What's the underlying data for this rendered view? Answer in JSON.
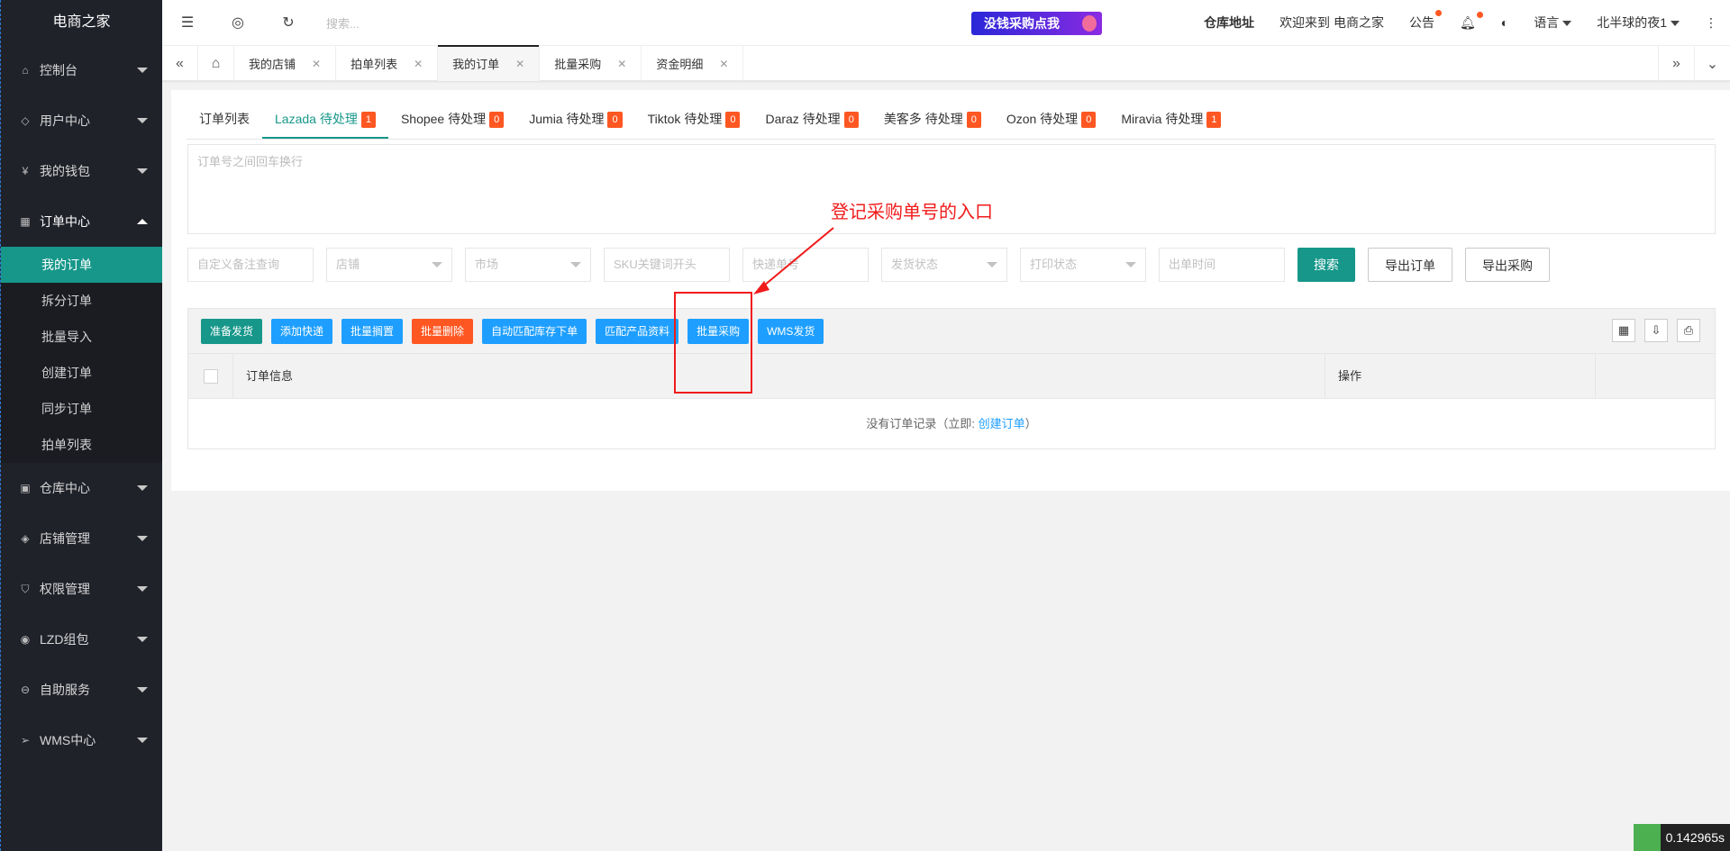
{
  "app": {
    "title": "电商之家"
  },
  "sidebar": {
    "groups": [
      {
        "label": "控制台",
        "icon": "home-icon"
      },
      {
        "label": "用户中心",
        "icon": "diamond-icon"
      },
      {
        "label": "我的钱包",
        "icon": "wallet-icon"
      },
      {
        "label": "订单中心",
        "icon": "apps-icon",
        "open": true,
        "items": [
          "我的订单",
          "拆分订单",
          "批量导入",
          "创建订单",
          "同步订单",
          "拍单列表"
        ]
      },
      {
        "label": "仓库中心",
        "icon": "warehouse-icon"
      },
      {
        "label": "店铺管理",
        "icon": "box-icon"
      },
      {
        "label": "权限管理",
        "icon": "shield-icon"
      },
      {
        "label": "LZD组包",
        "icon": "compass-icon"
      },
      {
        "label": "自助服务",
        "icon": "service-icon"
      },
      {
        "label": "WMS中心",
        "icon": "send-icon"
      }
    ]
  },
  "header": {
    "search_placeholder": "搜索...",
    "promo": "没钱采购点我",
    "warehouse": "仓库地址",
    "welcome": "欢迎来到 电商之家",
    "notice": "公告",
    "language": "语言",
    "user": "北半球的夜1"
  },
  "tabs": [
    "我的店铺",
    "拍单列表",
    "我的订单",
    "批量采购",
    "资金明细"
  ],
  "order_tabs": [
    {
      "label": "订单列表"
    },
    {
      "label": "Lazada 待处理",
      "count": "1"
    },
    {
      "label": "Shopee 待处理",
      "count": "0"
    },
    {
      "label": "Jumia 待处理",
      "count": "0"
    },
    {
      "label": "Tiktok 待处理",
      "count": "0"
    },
    {
      "label": "Daraz 待处理",
      "count": "0"
    },
    {
      "label": "美客多 待处理",
      "count": "0"
    },
    {
      "label": "Ozon 待处理",
      "count": "0"
    },
    {
      "label": "Miravia 待处理",
      "count": "1"
    }
  ],
  "textarea_placeholder": "订单号之间回车换行",
  "filters": {
    "remark": "自定义备注查询",
    "shop": "店铺",
    "market": "市场",
    "sku": "SKU关键词开头",
    "express": "快递单号",
    "ship_status": "发货状态",
    "print_status": "打印状态",
    "order_time": "出单时间",
    "search_btn": "搜索",
    "export_orders": "导出订单",
    "export_purchase": "导出采购"
  },
  "toolbar_buttons": [
    {
      "label": "准备发货",
      "color": "#16978a"
    },
    {
      "label": "添加快递",
      "color": "#1e9fff"
    },
    {
      "label": "批量搁置",
      "color": "#1e9fff"
    },
    {
      "label": "批量删除",
      "color": "#ff5722"
    },
    {
      "label": "自动匹配库存下单",
      "color": "#1e9fff"
    },
    {
      "label": "匹配产品资料",
      "color": "#1e9fff"
    },
    {
      "label": "批量采购",
      "color": "#1e9fff"
    },
    {
      "label": "WMS发货",
      "color": "#1e9fff"
    }
  ],
  "table": {
    "col_info": "订单信息",
    "col_op": "操作",
    "empty_text": "没有订单记录（立即: ",
    "empty_link": "创建订单",
    "empty_tail": "）"
  },
  "annotation": {
    "text": "登记采购单号的入口",
    "color": "#f01b1b"
  },
  "timer": "0.142965s"
}
